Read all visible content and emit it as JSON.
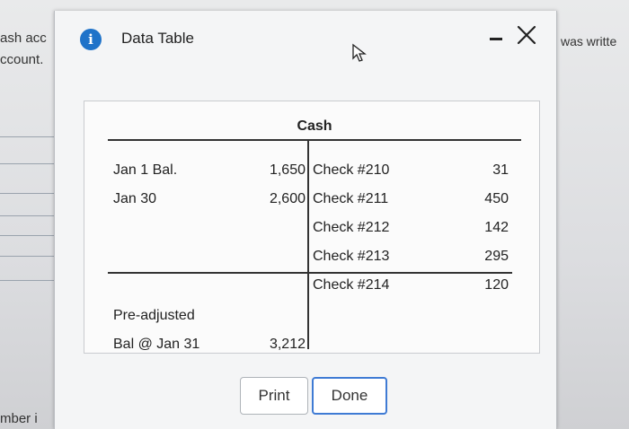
{
  "background": {
    "left_text_1": "ash acc",
    "left_text_2": "ccount.",
    "right_text": "was writte",
    "bottom_text": "mber i"
  },
  "dialog": {
    "title": "Data Table",
    "info_icon": "info-icon",
    "info_glyph": "i",
    "print_label": "Print",
    "done_label": "Done"
  },
  "table": {
    "account_title": "Cash",
    "rows": [
      {
        "dr_label": "Jan  1 Bal.",
        "dr_amount": "1,650",
        "cr_label": "Check #210",
        "cr_amount": "31"
      },
      {
        "dr_label": "Jan  30",
        "dr_amount": "2,600",
        "cr_label": "Check #211",
        "cr_amount": "450"
      },
      {
        "dr_label": "",
        "dr_amount": "",
        "cr_label": "Check #212",
        "cr_amount": "142"
      },
      {
        "dr_label": "",
        "dr_amount": "",
        "cr_label": "Check #213",
        "cr_amount": "295"
      },
      {
        "dr_label": "",
        "dr_amount": "",
        "cr_label": "Check #214",
        "cr_amount": "120"
      }
    ],
    "balance_label_1": "Pre-adjusted",
    "balance_label_2": "Bal @ Jan 31",
    "balance_amount": "3,212"
  },
  "colors": {
    "info_blue": "#1f73c9",
    "done_border": "#3f7bd4"
  }
}
